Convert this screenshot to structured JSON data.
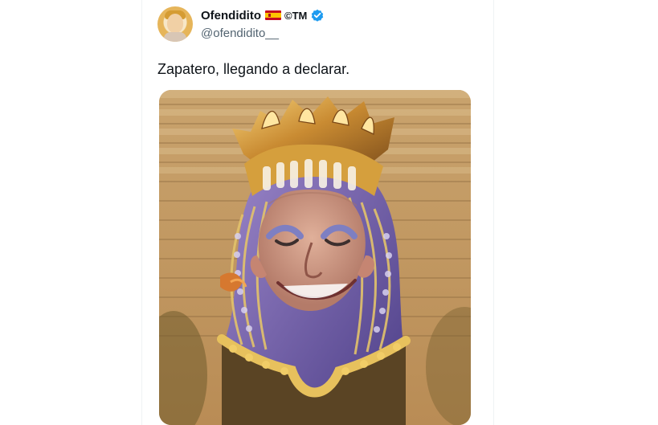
{
  "tweet": {
    "author": {
      "display_name": "Ofendidito",
      "symbols": "©TM",
      "handle": "@ofendidito__"
    },
    "text": "Zapatero, llegando a declarar.",
    "icons": {
      "flag": "spain-flag-icon",
      "verified": "verified-badge-icon"
    }
  },
  "colors": {
    "verified_blue": "#1d9bf0",
    "handle_gray": "#536471",
    "text_dark": "#0f1419"
  }
}
